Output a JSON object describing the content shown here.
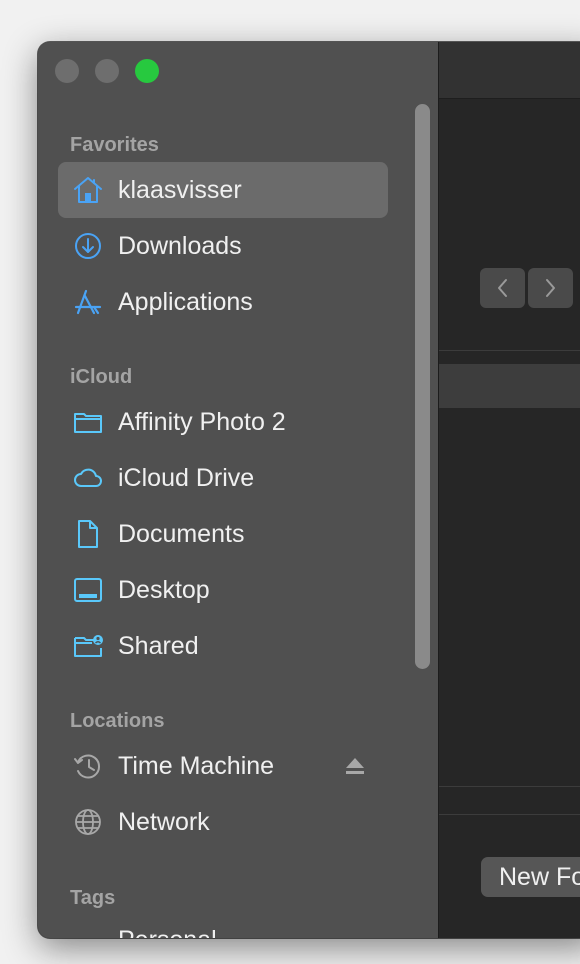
{
  "sidebar": {
    "sections": [
      {
        "title": "Favorites"
      },
      {
        "title": "iCloud"
      },
      {
        "title": "Locations"
      },
      {
        "title": "Tags"
      }
    ],
    "favorites": [
      {
        "label": "klaasvisser",
        "icon": "home-icon",
        "selected": true
      },
      {
        "label": "Downloads",
        "icon": "download-circle-icon"
      },
      {
        "label": "Applications",
        "icon": "app-store-a-icon"
      }
    ],
    "icloud": [
      {
        "label": "Affinity Photo 2",
        "icon": "folder-icon"
      },
      {
        "label": "iCloud Drive",
        "icon": "cloud-icon"
      },
      {
        "label": "Documents",
        "icon": "document-icon"
      },
      {
        "label": "Desktop",
        "icon": "desktop-icon"
      },
      {
        "label": "Shared",
        "icon": "shared-folder-icon"
      }
    ],
    "locations": [
      {
        "label": "Time Machine",
        "icon": "time-machine-icon",
        "eject": "eject-icon"
      },
      {
        "label": "Network",
        "icon": "globe-network-icon"
      }
    ],
    "tags": [
      {
        "label": "Personal",
        "color": "#e063e0"
      }
    ]
  },
  "main": {
    "new_folder_label": "New Folder"
  },
  "colors": {
    "accent": "#4aa3f5",
    "sidebar_bg": "#505050",
    "selected_bg": "#6b6b6b",
    "window_bg": "#262626"
  }
}
